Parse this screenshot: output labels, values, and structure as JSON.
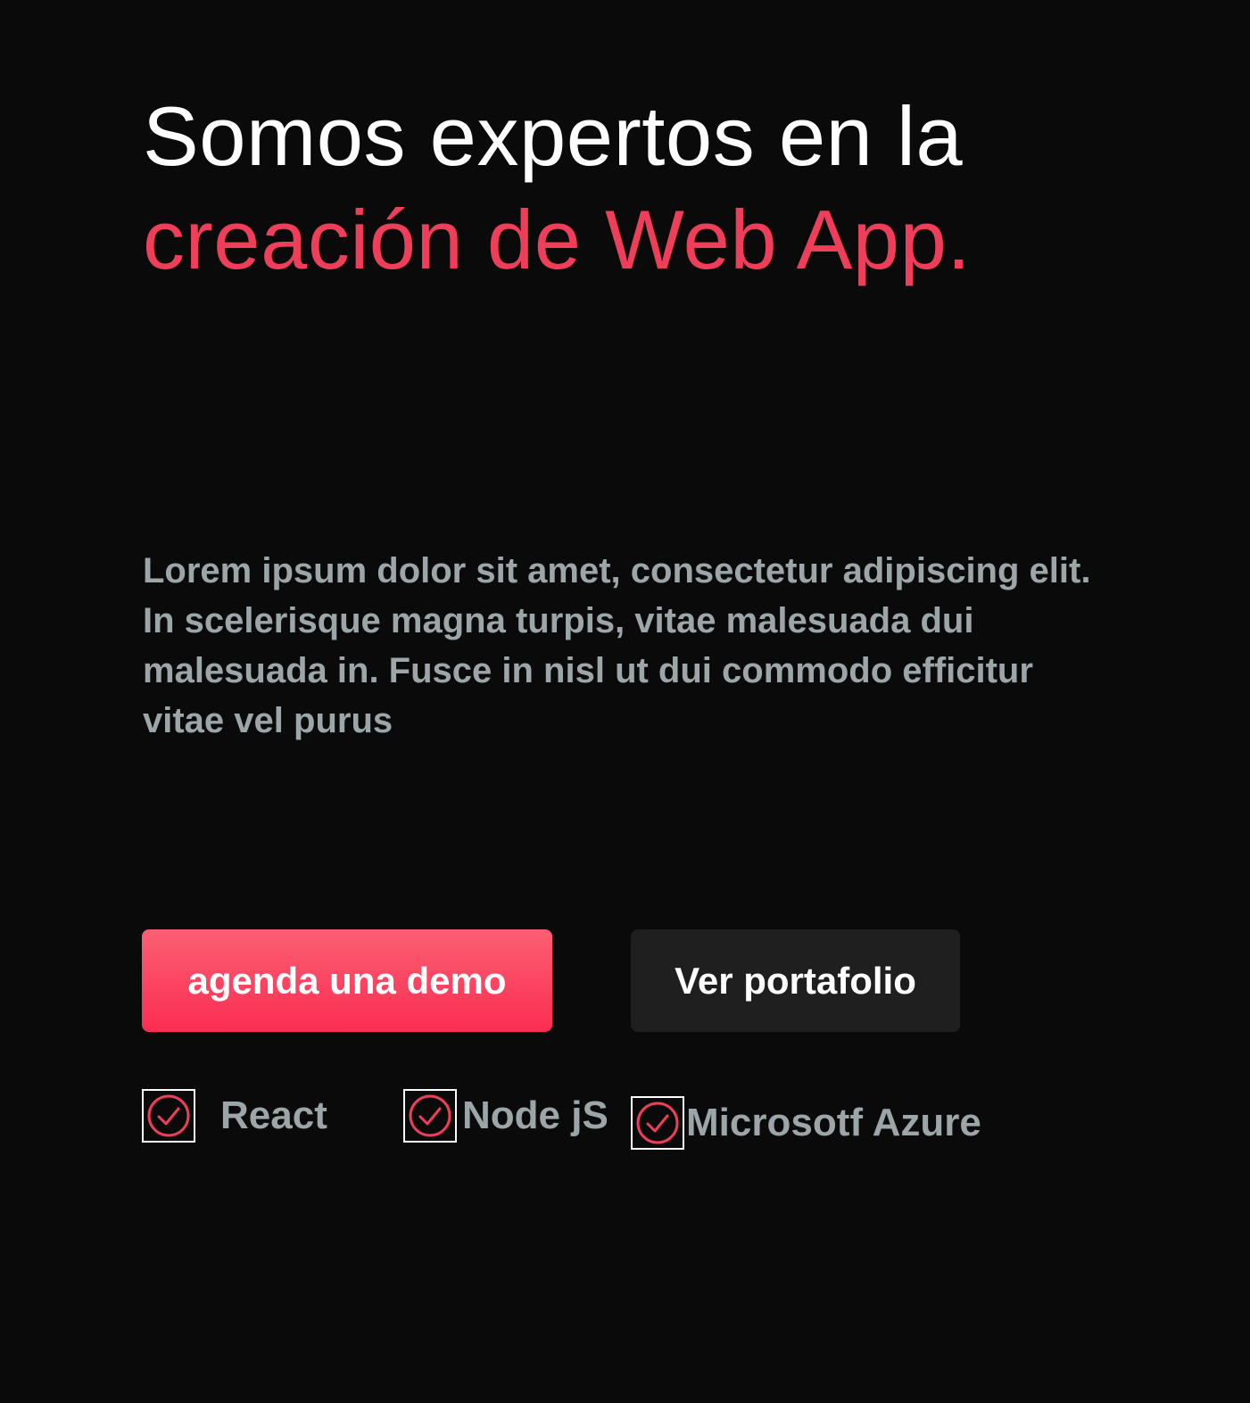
{
  "colors": {
    "background": "#0a0a0a",
    "accent": "#ef3e5a",
    "primary_button": "#fb4560",
    "secondary_button": "#1f1f1f",
    "muted_text": "#9ca6a8"
  },
  "hero": {
    "headline_line1": "Somos expertos en la",
    "headline_line2": "creación de Web App.",
    "description": "Lorem ipsum dolor sit amet, consectetur adipiscing elit. In scelerisque magna turpis, vitae malesuada dui malesuada in. Fusce in nisl ut dui commodo efficitur vitae vel purus"
  },
  "buttons": {
    "primary_label": "agenda una demo",
    "secondary_label": "Ver portafolio"
  },
  "technologies": [
    {
      "label": "React",
      "icon": "check-circle-icon"
    },
    {
      "label": "Node jS",
      "icon": "check-circle-icon"
    },
    {
      "label": "Microsotf Azure",
      "icon": "check-circle-icon"
    }
  ]
}
